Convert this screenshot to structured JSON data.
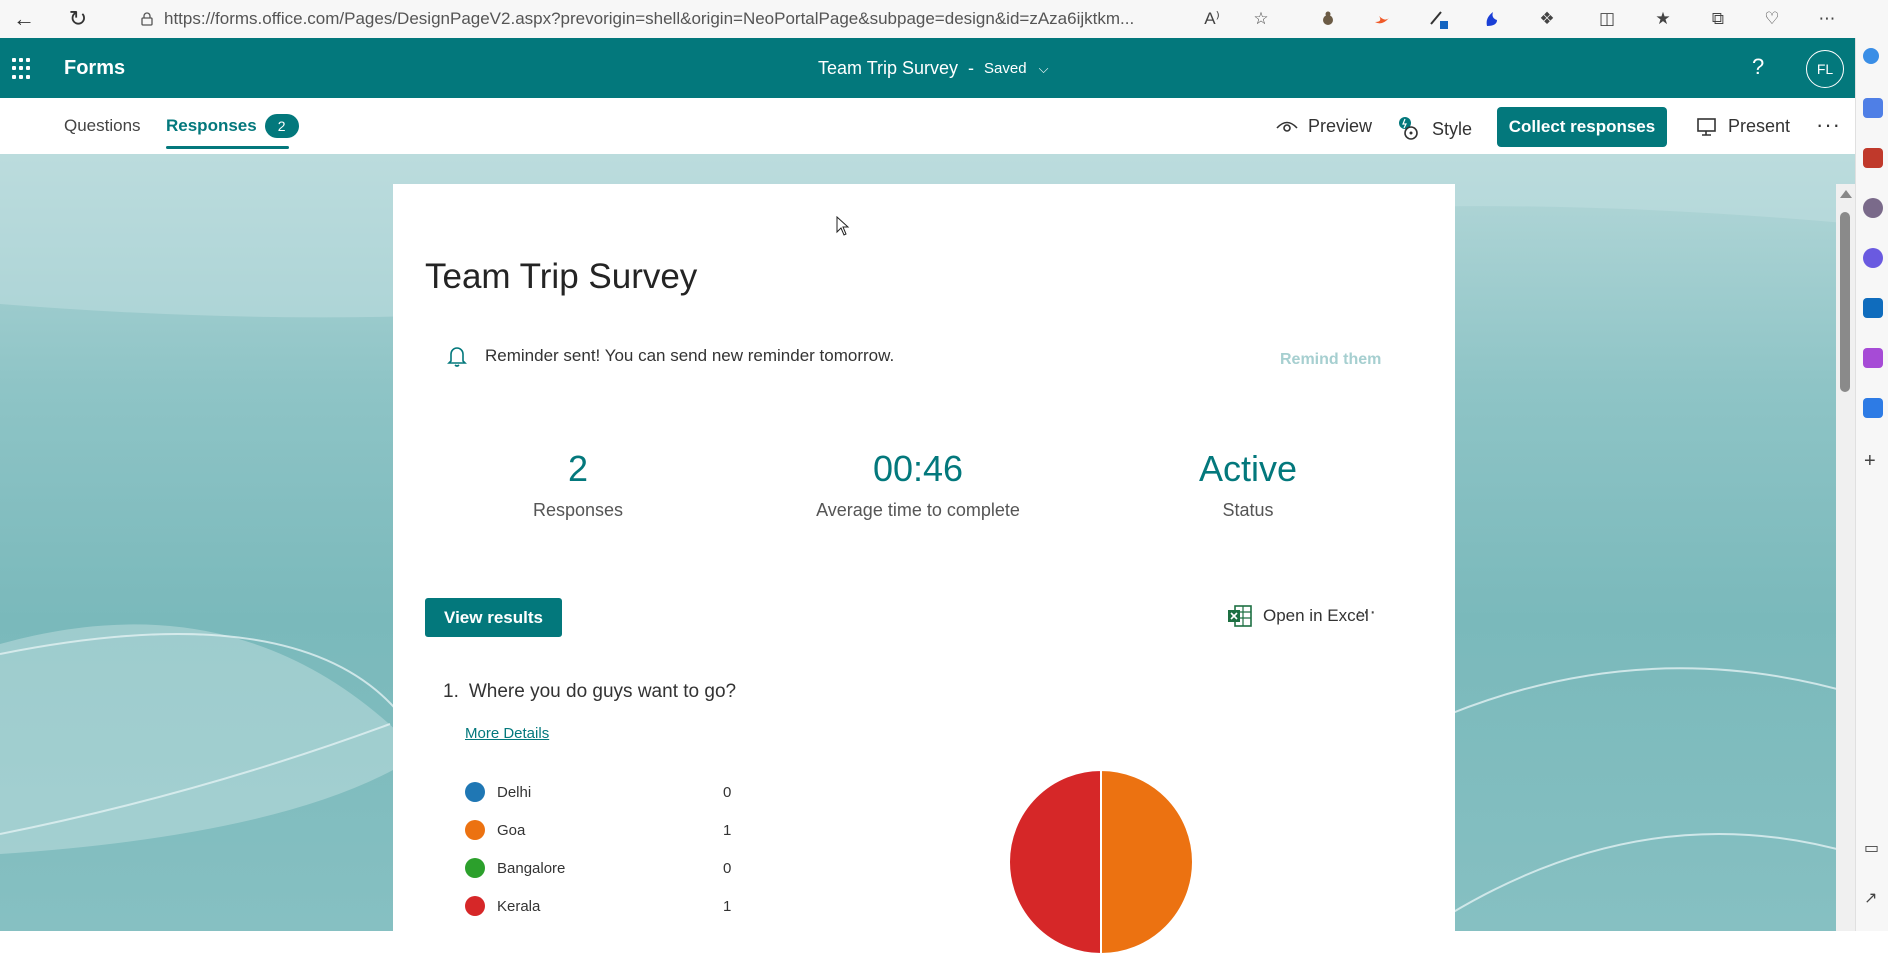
{
  "browser": {
    "url": "https://forms.office.com/Pages/DesignPageV2.aspx?prevorigin=shell&origin=NeoPortalPage&subpage=design&id=zAza6ijktkm...",
    "read_aloud_glyph": "A⁾"
  },
  "header": {
    "app_name": "Forms",
    "doc_title": "Team Trip Survey",
    "separator": "-",
    "save_status": "Saved",
    "help_glyph": "?",
    "avatar_initials": "FL"
  },
  "toolbar": {
    "tabs": [
      {
        "label": "Questions",
        "active": false
      },
      {
        "label": "Responses",
        "active": true,
        "badge": "2"
      }
    ],
    "preview_label": "Preview",
    "style_label": "Style",
    "collect_label": "Collect responses",
    "present_label": "Present",
    "more_glyph": "···"
  },
  "card": {
    "title": "Team Trip Survey",
    "reminder_text": "Reminder sent! You can send new reminder tomorrow.",
    "remind_button": "Remind them",
    "stats": [
      {
        "value": "2",
        "label": "Responses"
      },
      {
        "value": "00:46",
        "label": "Average time to complete"
      },
      {
        "value": "Active",
        "label": "Status"
      }
    ],
    "view_results_label": "View results",
    "open_excel_label": "Open in Excel",
    "more_glyph": "···"
  },
  "question": {
    "number": "1.",
    "text": "Where you do guys want to go?",
    "more_details": "More Details",
    "options": [
      {
        "label": "Delhi",
        "count": "0",
        "color": "#1f77b4"
      },
      {
        "label": "Goa",
        "count": "1",
        "color": "#ec7211"
      },
      {
        "label": "Bangalore",
        "count": "0",
        "color": "#2ca02c"
      },
      {
        "label": "Kerala",
        "count": "1",
        "color": "#d62728"
      }
    ]
  },
  "chart_data": {
    "type": "pie",
    "categories": [
      "Delhi",
      "Goa",
      "Bangalore",
      "Kerala"
    ],
    "values": [
      0,
      1,
      0,
      1
    ],
    "colors": [
      "#1f77b4",
      "#ec7211",
      "#2ca02c",
      "#d62728"
    ]
  },
  "colors": {
    "brand": "#03787c"
  }
}
